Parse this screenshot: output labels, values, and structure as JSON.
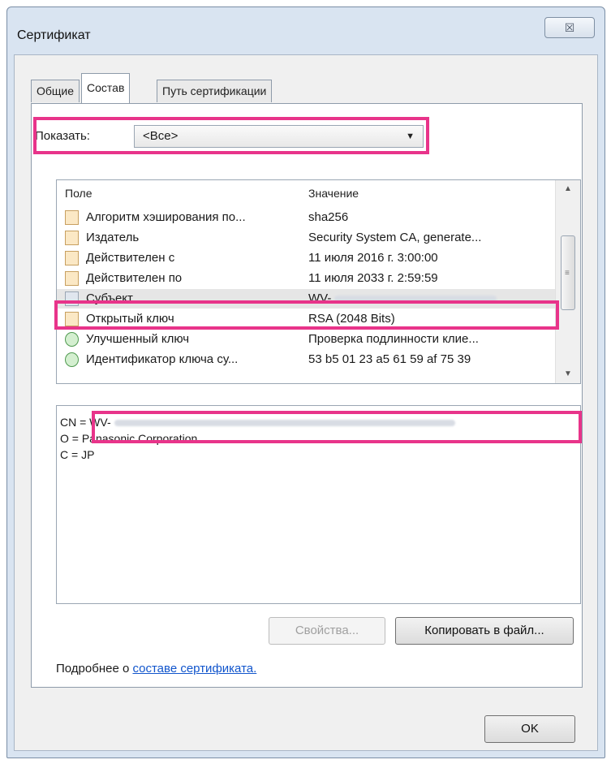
{
  "window": {
    "title": "Сертификат",
    "close_glyph": "☒"
  },
  "tabs": [
    {
      "label": "Общие"
    },
    {
      "label": "Состав"
    },
    {
      "label": "Путь сертификации"
    }
  ],
  "show": {
    "label": "Показать:",
    "selected": "<Все>"
  },
  "fields_list": {
    "columns": [
      "Поле",
      "Значение"
    ],
    "rows": [
      {
        "field": "Алгоритм хэширования по...",
        "value": "sha256"
      },
      {
        "field": "Издатель",
        "value": "Security System CA, generate..."
      },
      {
        "field": "Действителен с",
        "value": "11 июля 2016 г. 3:00:00"
      },
      {
        "field": "Действителен по",
        "value": "11 июля 2033 г. 2:59:59"
      },
      {
        "field": "Субъект",
        "value": "WV-"
      },
      {
        "field": "Открытый ключ",
        "value": "RSA (2048 Bits)"
      },
      {
        "field": "Улучшенный ключ",
        "value": "Проверка подлинности клие..."
      },
      {
        "field": "Идентификатор ключа су...",
        "value": "53 b5 01 23 a5 61 59 af 75 39"
      }
    ]
  },
  "details": {
    "lines": [
      "CN = WV-",
      "O = Panasonic Corporation",
      "C = JP"
    ]
  },
  "buttons": {
    "properties": "Свойства...",
    "copy_to_file": "Копировать в файл...",
    "ok": "OK"
  },
  "more_info": {
    "prefix": "Подробнее о ",
    "link": "составе сертификата."
  },
  "colors": {
    "highlight": "#e8348a",
    "link": "#1155cc"
  }
}
